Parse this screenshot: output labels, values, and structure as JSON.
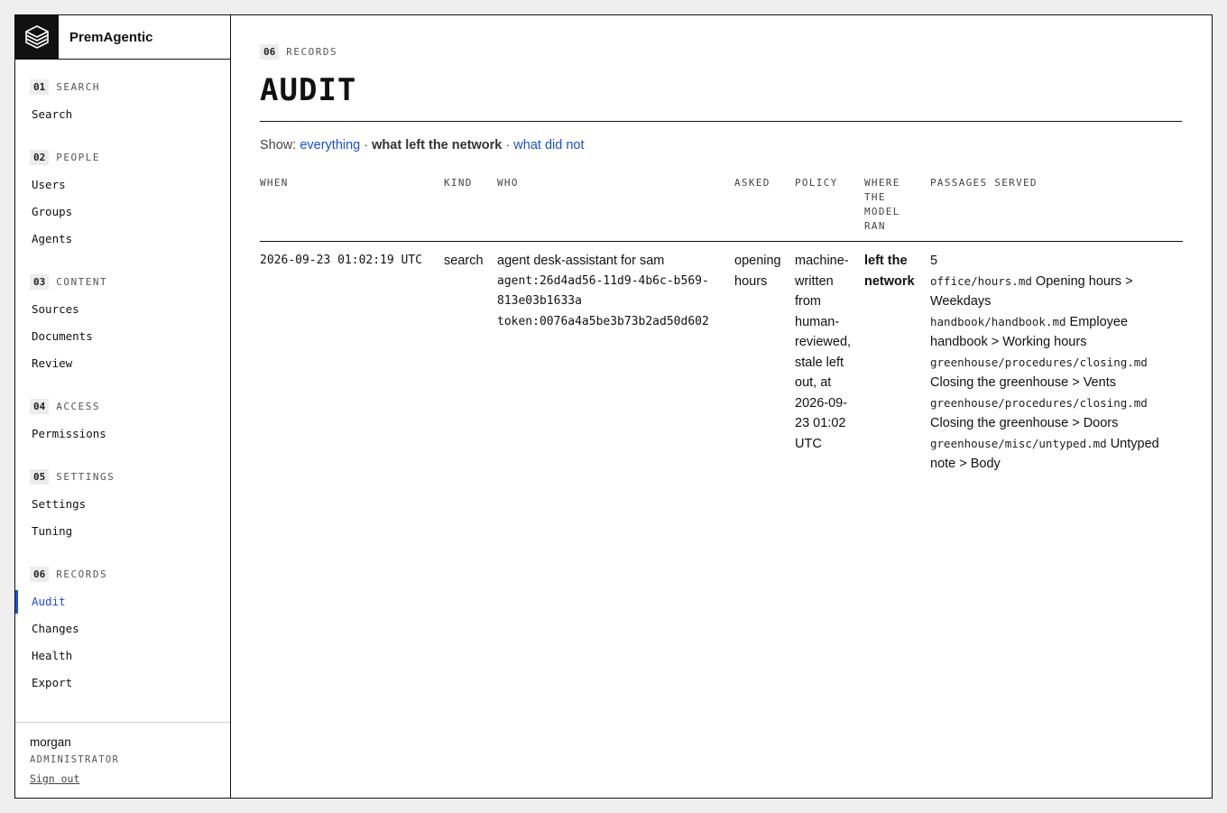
{
  "app": {
    "name": "PremAgentic",
    "logo_icon": "layers-cube-icon"
  },
  "nav": {
    "sections": [
      {
        "num": "01",
        "title": "SEARCH",
        "items": [
          "Search"
        ]
      },
      {
        "num": "02",
        "title": "PEOPLE",
        "items": [
          "Users",
          "Groups",
          "Agents"
        ]
      },
      {
        "num": "03",
        "title": "CONTENT",
        "items": [
          "Sources",
          "Documents",
          "Review"
        ]
      },
      {
        "num": "04",
        "title": "ACCESS",
        "items": [
          "Permissions"
        ]
      },
      {
        "num": "05",
        "title": "SETTINGS",
        "items": [
          "Settings",
          "Tuning"
        ]
      },
      {
        "num": "06",
        "title": "RECORDS",
        "items": [
          "Audit",
          "Changes",
          "Health",
          "Export"
        ]
      }
    ],
    "active": "Audit",
    "accent": "#1a4fd6"
  },
  "user": {
    "name": "morgan",
    "role": "ADMINISTRATOR",
    "signout": "Sign out"
  },
  "page": {
    "section_num": "06",
    "section_title": "RECORDS",
    "title": "AUDIT",
    "show_label": "Show:",
    "filters": [
      {
        "label": "everything",
        "current": false
      },
      {
        "label": "what left the network",
        "current": true
      },
      {
        "label": "what did not",
        "current": false
      }
    ],
    "separator": "·"
  },
  "table": {
    "headers": [
      "WHEN",
      "KIND",
      "WHO",
      "ASKED",
      "POLICY",
      "WHERE THE MODEL RAN",
      "PASSAGES SERVED"
    ],
    "rows": [
      {
        "when": "2026-09-23 01:02:19 UTC",
        "kind": "search",
        "who_name": "agent desk-assistant for sam",
        "who_agent": "agent:26d4ad56-11d9-4b6c-b569-813e03b1633a",
        "who_token": "token:0076a4a5be3b73b2ad50d602",
        "asked": "opening hours",
        "policy": "machine-written from human-reviewed, stale left out, at 2026-09-23 01:02 UTC",
        "where": "left the network",
        "passages_count": "5",
        "passages": [
          {
            "path": "office/hours.md",
            "title": "Opening hours > Weekdays"
          },
          {
            "path": "handbook/handbook.md",
            "title": "Employee handbook > Working hours"
          },
          {
            "path": "greenhouse/procedures/closing.md",
            "title": "Closing the greenhouse > Vents"
          },
          {
            "path": "greenhouse/procedures/closing.md",
            "title": "Closing the greenhouse > Doors"
          },
          {
            "path": "greenhouse/misc/untyped.md",
            "title": "Untyped note > Body"
          }
        ]
      }
    ]
  }
}
